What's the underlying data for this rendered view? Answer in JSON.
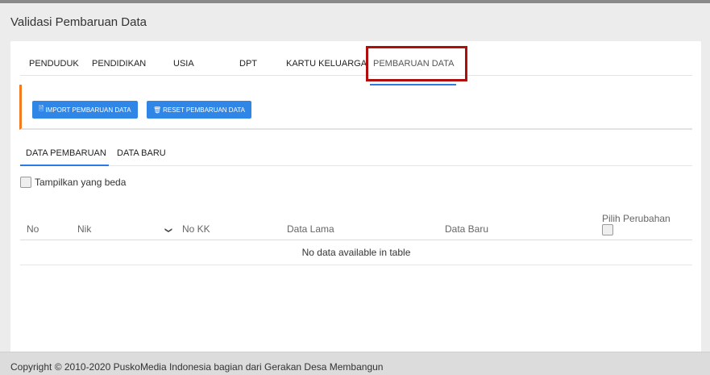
{
  "page": {
    "title": "Validasi Pembaruan Data",
    "footer": "Copyright © 2010-2020 PuskoMedia Indonesia bagian dari Gerakan Desa Membangun"
  },
  "main_tabs": [
    {
      "label": "PENDUDUK"
    },
    {
      "label": "PENDIDIKAN"
    },
    {
      "label": "USIA"
    },
    {
      "label": "DPT"
    },
    {
      "label": "KARTU KELUARGA"
    },
    {
      "label": "PEMBARUAN DATA",
      "active": true
    }
  ],
  "actions": {
    "import_label": "IMPORT PEMBARUAN DATA",
    "import_icon": "file-icon",
    "reset_label": "RESET PEMBARUAN DATA",
    "reset_icon": "trash-icon",
    "accent_color": "#f47a1f",
    "button_color": "#2f86e6"
  },
  "sub_tabs": [
    {
      "label": "DATA PEMBARUAN",
      "active": true
    },
    {
      "label": "DATA BARU"
    }
  ],
  "filter": {
    "show_diff_label": "Tampilkan yang beda",
    "checked": false
  },
  "table": {
    "columns": [
      "No",
      "Nik",
      "No KK",
      "Data Lama",
      "Data Baru",
      "Pilih Perubahan"
    ],
    "empty_message": "No data available in table"
  },
  "highlight_color": "#b00d0d"
}
